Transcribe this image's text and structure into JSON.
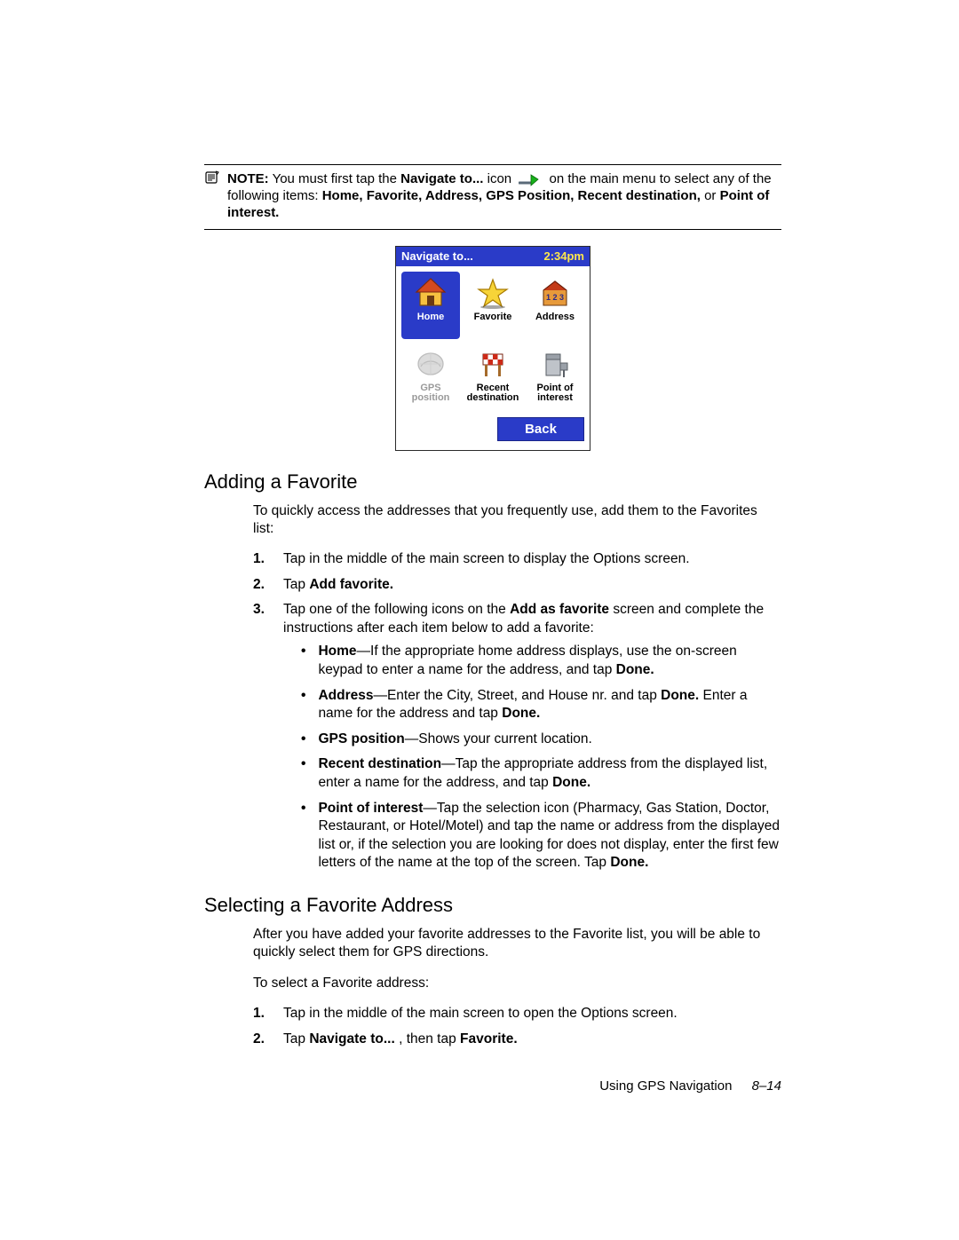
{
  "note": {
    "prefix": "NOTE:",
    "part1": "You must first tap the ",
    "bold1": "Navigate to...",
    "part2": " icon ",
    "part3": " on the main menu to select any of the following items: ",
    "bold2": "Home, Favorite, Address, GPS Position, Recent destination,",
    "part4": " or ",
    "bold3": "Point of interest."
  },
  "device": {
    "title": "Navigate to...",
    "time": "2:34pm",
    "apps": [
      {
        "label": "Home",
        "kind": "home",
        "selected": true,
        "disabled": false
      },
      {
        "label": "Favorite",
        "kind": "favorite",
        "selected": false,
        "disabled": false
      },
      {
        "label": "Address",
        "kind": "address",
        "selected": false,
        "disabled": false
      },
      {
        "label": "GPS\nposition",
        "kind": "gps",
        "selected": false,
        "disabled": true
      },
      {
        "label": "Recent\ndestination",
        "kind": "recent",
        "selected": false,
        "disabled": false
      },
      {
        "label": "Point of\ninterest",
        "kind": "poi",
        "selected": false,
        "disabled": false
      }
    ],
    "back": "Back"
  },
  "section1": {
    "title": "Adding a Favorite",
    "intro": "To quickly access the addresses that you frequently use, add them to the Favorites list:",
    "step1": "Tap in the middle of the main screen to display the Options screen.",
    "step2_pre": "Tap ",
    "step2_b": "Add favorite.",
    "step3_pre": "Tap one of the following icons on the ",
    "step3_b": "Add as favorite",
    "step3_post": " screen and complete the instructions after each item below to add a favorite:",
    "bullets": {
      "b1_b": "Home",
      "b1": "—If the appropriate home address displays, use the on-screen keypad to enter a name for the address, and tap ",
      "b1_done": "Done.",
      "b2_b": "Address",
      "b2a": "—Enter the City, Street, and House nr. and tap ",
      "b2_done1": "Done.",
      "b2b": " Enter a name for the address and tap ",
      "b2_done2": "Done.",
      "b3_b": "GPS position",
      "b3": "—Shows your current location.",
      "b4_b": "Recent destination",
      "b4": "—Tap the appropriate address from the displayed list, enter a name for the address, and tap ",
      "b4_done": "Done.",
      "b5_b": "Point of interest",
      "b5": "—Tap the selection icon (Pharmacy, Gas Station, Doctor, Restaurant, or Hotel/Motel) and tap the name or address from the displayed list or, if the selection you are looking for does not display, enter the first few letters of the name at the top of the screen. Tap ",
      "b5_done": "Done."
    }
  },
  "section2": {
    "title": "Selecting a Favorite Address",
    "intro": "After you have added your favorite addresses to the Favorite list, you will be able to quickly select them for GPS directions.",
    "lead": "To select a Favorite address:",
    "step1": "Tap in the middle of the main screen to open the Options screen.",
    "step2_pre": "Tap ",
    "step2_b1": "Navigate to...",
    "step2_mid": " , then tap ",
    "step2_b2": "Favorite."
  },
  "footer": {
    "chapter": "Using GPS Navigation",
    "page": "8–14"
  }
}
